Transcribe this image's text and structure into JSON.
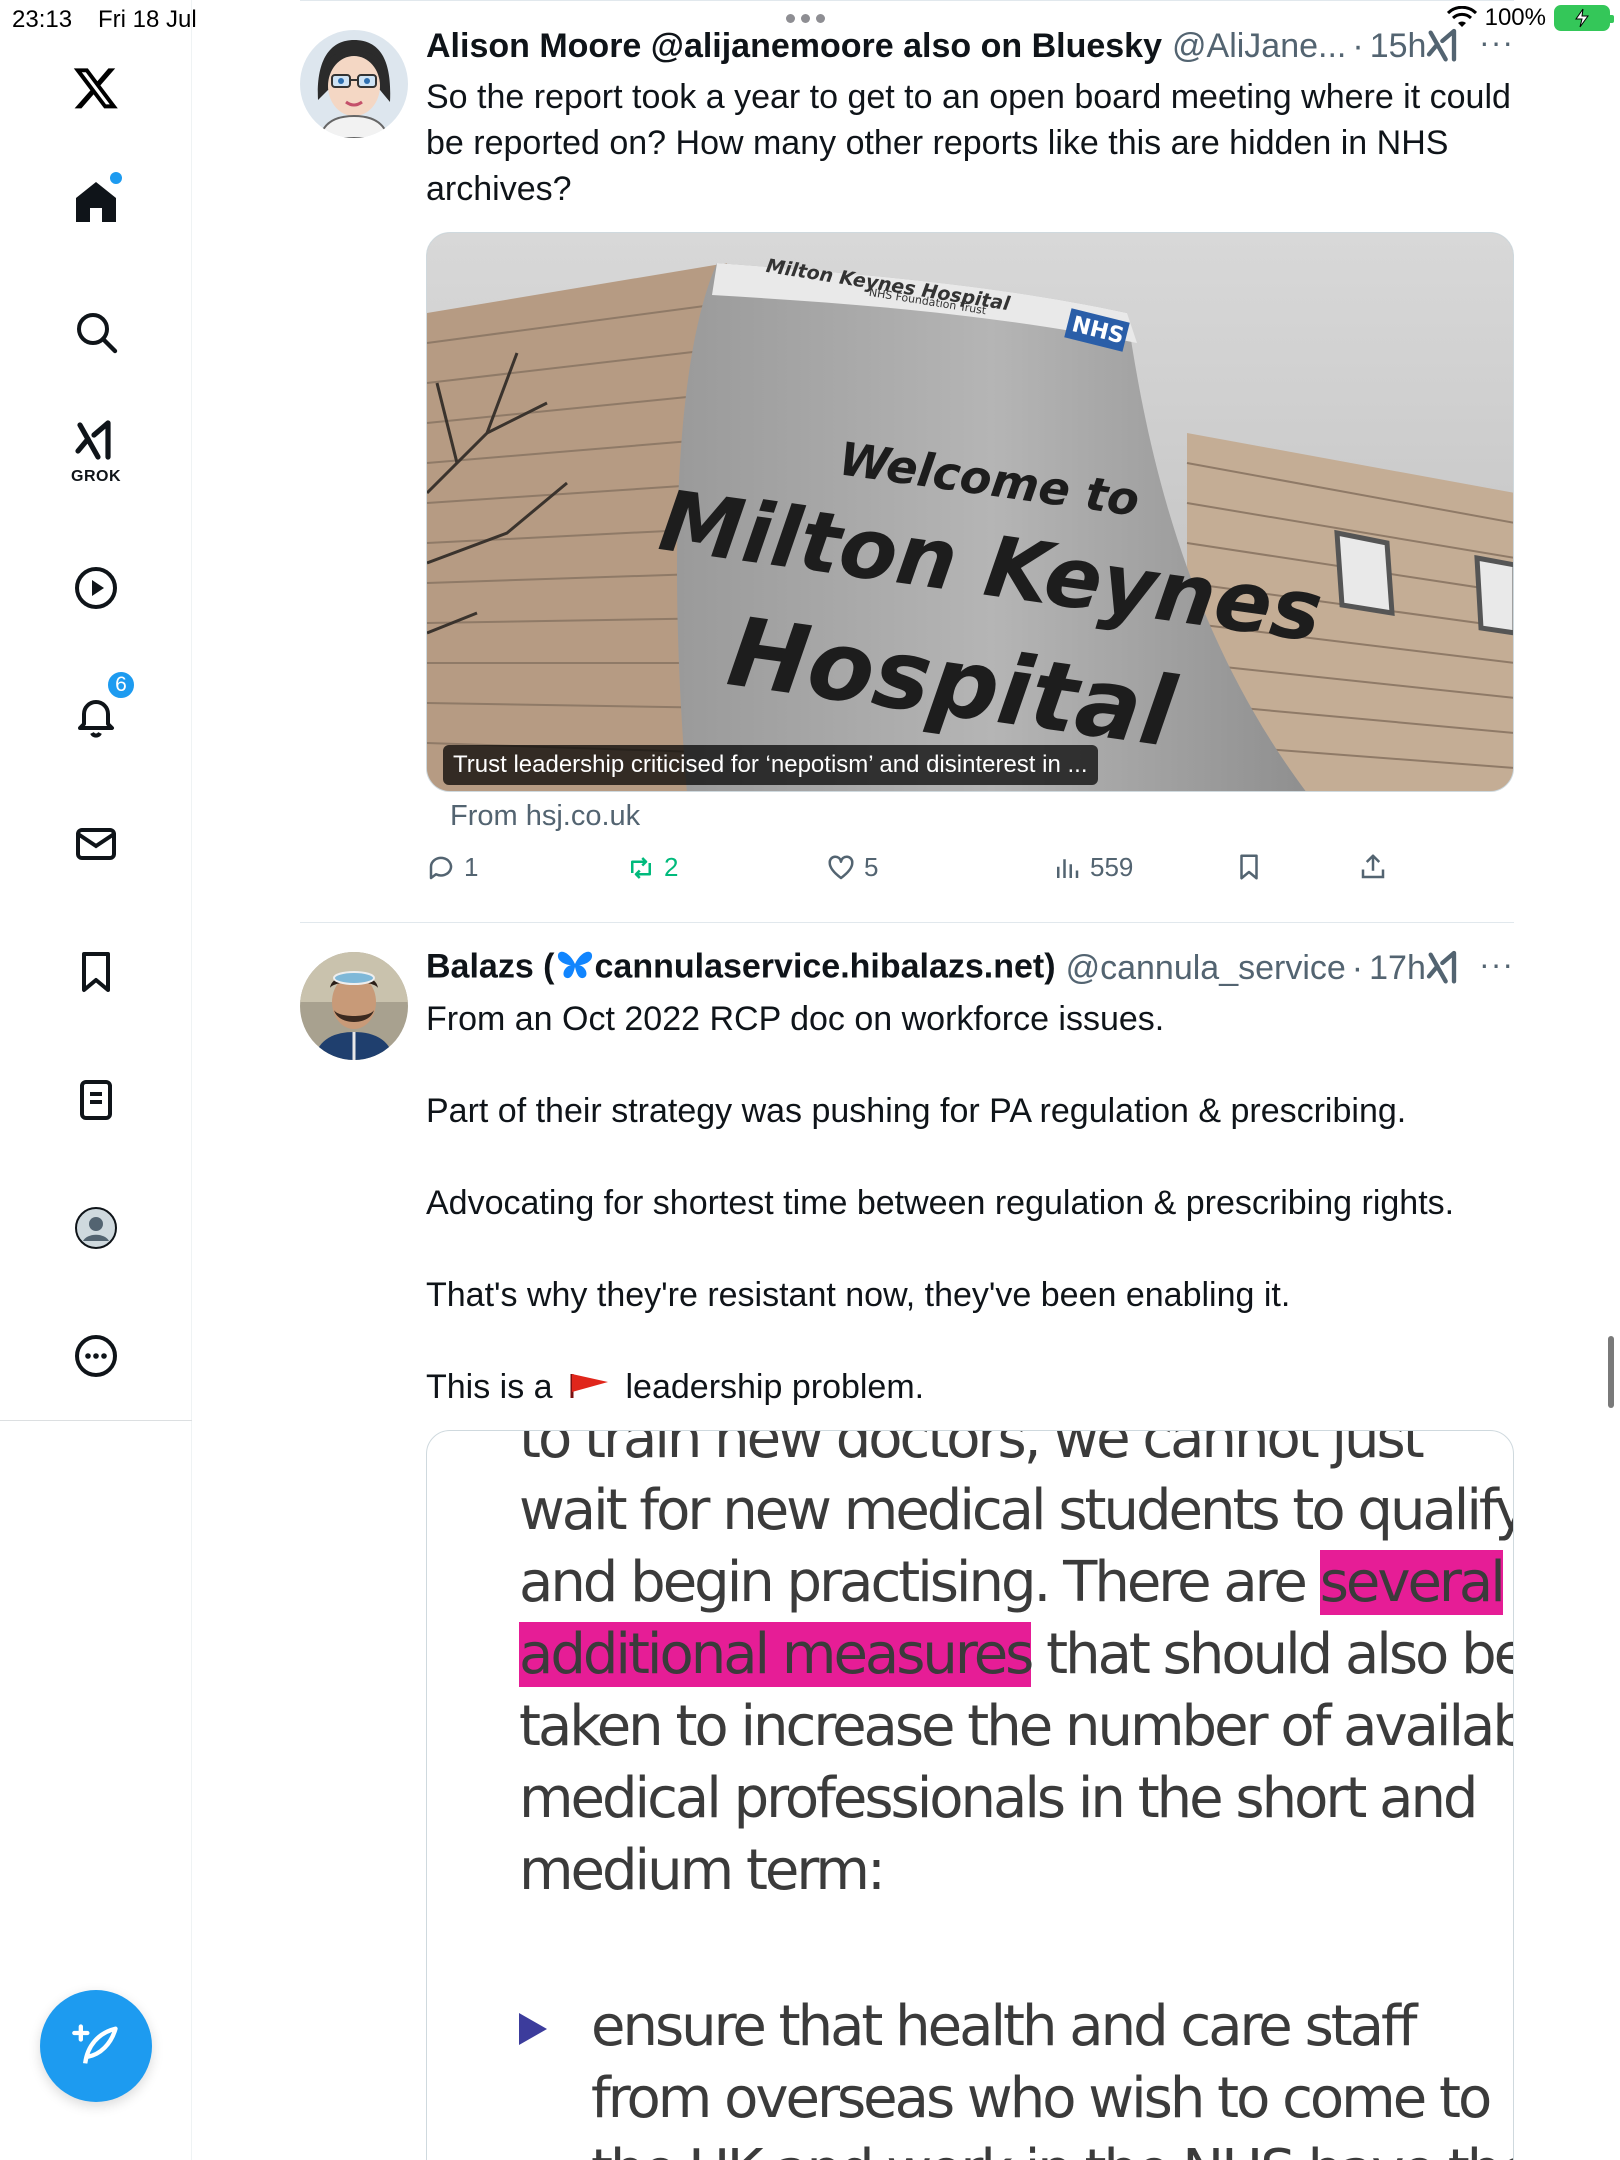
{
  "status_bar": {
    "time": "23:13",
    "date": "Fri 18 Jul",
    "battery": "100%"
  },
  "sidebar": {
    "grok_label": "GROK",
    "notifications_count": "6",
    "items": [
      {
        "icon": "x-logo-icon"
      },
      {
        "icon": "home-icon"
      },
      {
        "icon": "search-icon"
      },
      {
        "icon": "grok-icon"
      },
      {
        "icon": "video-icon"
      },
      {
        "icon": "bell-icon"
      },
      {
        "icon": "mail-icon"
      },
      {
        "icon": "bookmark-icon"
      },
      {
        "icon": "lists-icon"
      },
      {
        "icon": "profile-icon"
      },
      {
        "icon": "more-icon"
      }
    ]
  },
  "tweets": [
    {
      "name": "Alison Moore @alijanemoore also on Bluesky",
      "handle": "@AliJane...",
      "time": "15h",
      "text": "So the report took a year to get to an open board meeting where it could be reported on?  How many other reports like this are hidden in NHS archives?",
      "card": {
        "caption": "Trust leadership criticised for ‘nepotism’ and disinterest in ...",
        "source": "From hsj.co.uk",
        "sign_header": "Milton Keynes Hospital",
        "sign_sub": "NHS Foundation Trust",
        "sign_welcome": "Welcome to",
        "sign_line1": "Milton Keynes",
        "sign_line2": "Hospital",
        "nhs": "NHS"
      },
      "stats": {
        "replies": "1",
        "reposts": "2",
        "likes": "5",
        "views": "559"
      }
    },
    {
      "name_prefix": "Balazs (",
      "name_suffix": "cannulaservice.hibalazs.net)",
      "handle": "@cannula_service",
      "time": "17h",
      "paragraphs": [
        "From an Oct 2022 RCP doc on workforce issues.",
        "Part of their strategy was pushing for PA regulation & prescribing.",
        "Advocating for shortest time between regulation & prescribing rights.",
        "That's why they're resistant now, they've been enabling it."
      ],
      "last_line_before": "This is a",
      "last_line_after": "leadership problem.",
      "doc": {
        "line0": "to train new doctors, we cannot just",
        "line1": "wait for new medical students to qualify",
        "line2_a": "and begin practising. There are ",
        "line2_hl": "several",
        "line3_hl": "additional measures",
        "line3_b": " that should also be",
        "line4": "taken to increase the number of available",
        "line5": "medical professionals in the short and",
        "line6": "medium term:",
        "bullet1": "ensure that health and care staff",
        "bullet2": "from overseas who wish to come to",
        "bullet3": "the UK and work in the NHS have the"
      }
    }
  ],
  "colors": {
    "accent": "#1d9bf0",
    "repost_active": "#00ba7c",
    "highlight": "#e61d96"
  }
}
